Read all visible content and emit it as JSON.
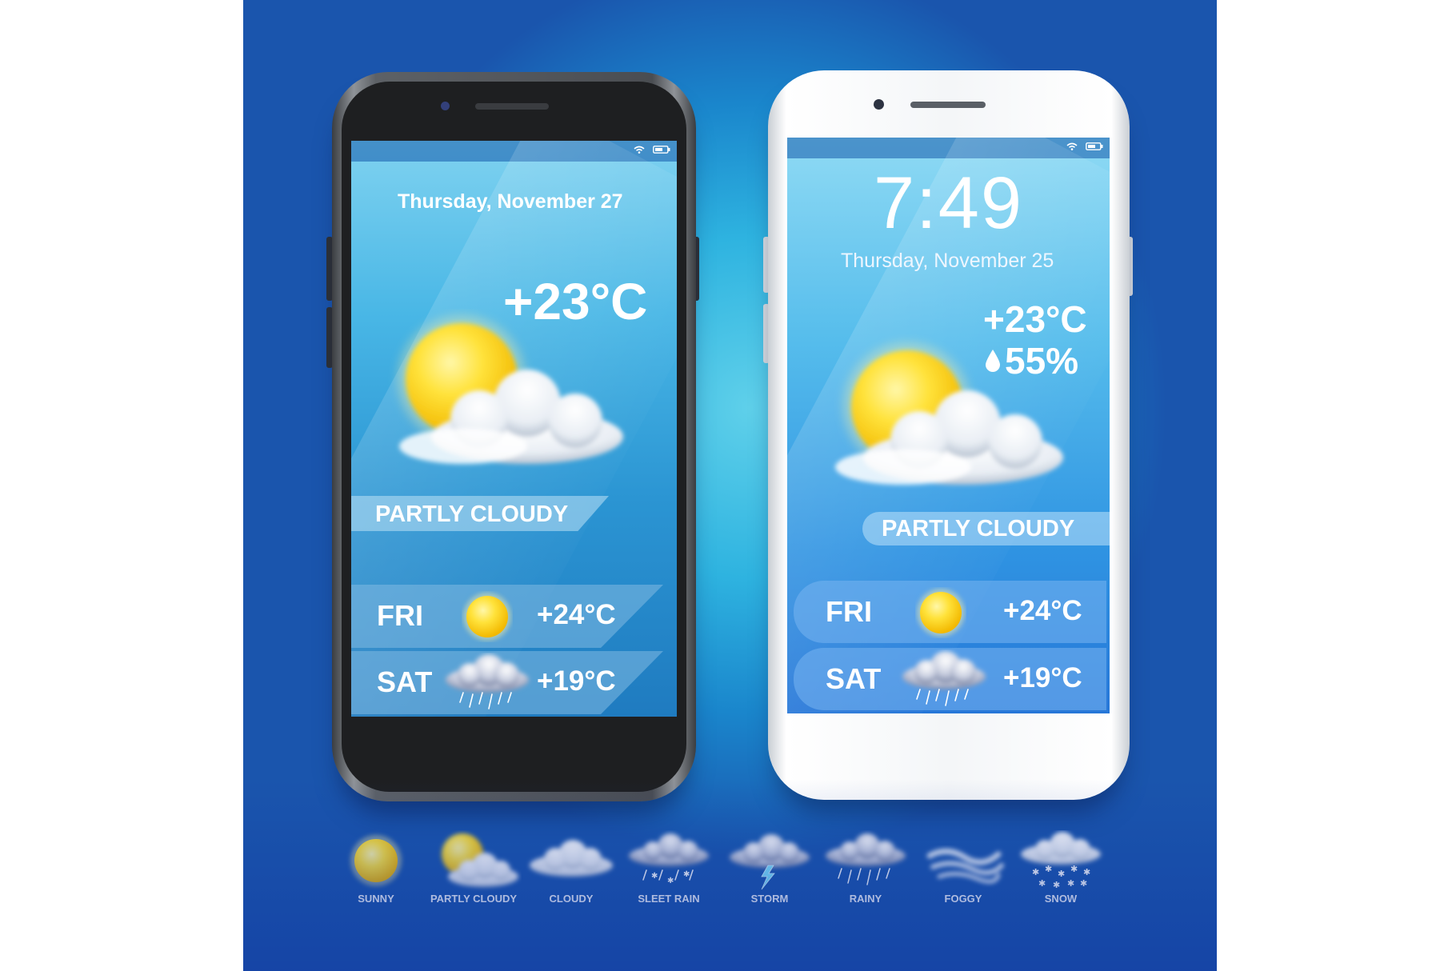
{
  "phone_dark": {
    "date": "Thursday, November 27",
    "temperature": "+23°C",
    "condition": "PARTLY CLOUDY",
    "forecast": [
      {
        "day": "FRI",
        "temp": "+24°C",
        "icon": "sunny-icon"
      },
      {
        "day": "SAT",
        "temp": "+19°C",
        "icon": "rainy-icon"
      }
    ]
  },
  "phone_white": {
    "time": "7:49",
    "date": "Thursday, November 25",
    "temperature": "+23°C",
    "humidity": "55%",
    "condition": "PARTLY CLOUDY",
    "forecast": [
      {
        "day": "FRI",
        "temp": "+24°C",
        "icon": "sunny-icon"
      },
      {
        "day": "SAT",
        "temp": "+19°C",
        "icon": "rainy-icon"
      }
    ]
  },
  "legend": [
    {
      "label": "SUNNY",
      "icon": "sunny-icon"
    },
    {
      "label": "PARTLY CLOUDY",
      "icon": "partly-cloudy-icon"
    },
    {
      "label": "CLOUDY",
      "icon": "cloud-icon"
    },
    {
      "label": "SLEET RAIN",
      "icon": "sleet-rain-icon"
    },
    {
      "label": "STORM",
      "icon": "storm-icon"
    },
    {
      "label": "RAINY",
      "icon": "rainy-icon"
    },
    {
      "label": "FOGGY",
      "icon": "foggy-icon"
    },
    {
      "label": "SNOW",
      "icon": "snow-icon"
    }
  ],
  "colors": {
    "background_light": "#5fd0ea",
    "background_dark": "#1a55ad",
    "sun": "#ffd21a",
    "text": "#ffffff"
  }
}
